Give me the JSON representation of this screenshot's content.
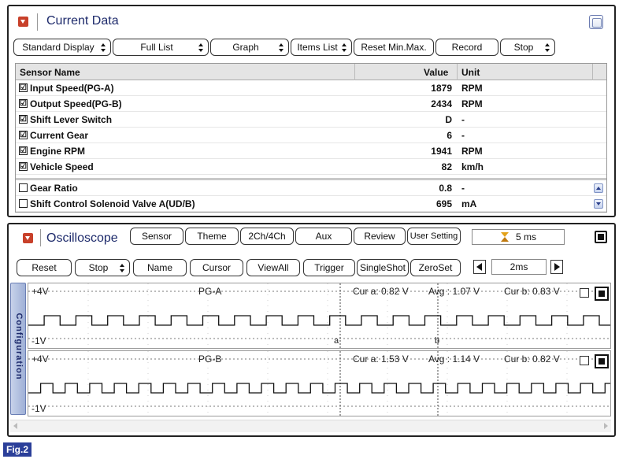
{
  "current_data": {
    "title": "Current Data",
    "toolbar": [
      {
        "label": "Standard Display",
        "spinner": true
      },
      {
        "label": "Full List",
        "spinner": true
      },
      {
        "label": "Graph",
        "spinner": true
      },
      {
        "label": "Items List",
        "spinner": true
      },
      {
        "label": "Reset Min.Max.",
        "spinner": false
      },
      {
        "label": "Record",
        "spinner": false
      },
      {
        "label": "Stop",
        "spinner": true
      }
    ],
    "columns": {
      "name": "Sensor Name",
      "value": "Value",
      "unit": "Unit"
    },
    "rows": [
      {
        "name": "Input Speed(PG-A)",
        "value": "1879",
        "unit": "RPM",
        "checked": true
      },
      {
        "name": "Output Speed(PG-B)",
        "value": "2434",
        "unit": "RPM",
        "checked": true
      },
      {
        "name": "Shift Lever Switch",
        "value": "D",
        "unit": "-",
        "checked": true
      },
      {
        "name": "Current Gear",
        "value": "6",
        "unit": "-",
        "checked": true
      },
      {
        "name": "Engine RPM",
        "value": "1941",
        "unit": "RPM",
        "checked": true
      },
      {
        "name": "Vehicle Speed",
        "value": "82",
        "unit": "km/h",
        "checked": true
      },
      {
        "name": "Gear Ratio",
        "value": "0.8",
        "unit": "-",
        "checked": false
      },
      {
        "name": "Shift Control Solenoid Valve A(UD/B)",
        "value": "695",
        "unit": "mA",
        "checked": false
      }
    ],
    "checkbox_glyph": "☑"
  },
  "oscilloscope": {
    "title": "Oscilloscope",
    "top_buttons": [
      "Sensor",
      "Theme",
      "2Ch/4Ch",
      "Aux",
      "Review",
      "User Setting"
    ],
    "time_display": "5 ms",
    "controls": [
      {
        "label": "Reset",
        "spinner": false
      },
      {
        "label": "Stop",
        "spinner": true
      },
      {
        "label": "Name",
        "spinner": false
      },
      {
        "label": "Cursor",
        "spinner": false
      },
      {
        "label": "ViewAll",
        "spinner": false
      },
      {
        "label": "Trigger",
        "spinner": false
      },
      {
        "label": "SingleShot",
        "spinner": false
      },
      {
        "label": "ZeroSet",
        "spinner": false
      }
    ],
    "timebase": "2ms",
    "configuration_label": "Configuration",
    "channels": [
      {
        "name": "PG-A",
        "top_level": "+4V",
        "bottom_level": "-1V",
        "cur_a": "Cur a: 0.82 V",
        "avg": "Avg : 1.07 V",
        "cur_b": "Cur b: 0.83 V",
        "marker_a": "a",
        "marker_b": "b",
        "pulse_period_ms": 1.06
      },
      {
        "name": "PG-B",
        "top_level": "+4V",
        "bottom_level": "-1V",
        "cur_a": "Cur a: 1.53 V",
        "avg": "Avg : 1.14 V",
        "cur_b": "Cur b: 0.82 V",
        "pulse_period_ms": 0.82
      }
    ]
  },
  "figure_label": "Fig.2",
  "colors": {
    "accent_red": "#c8402a",
    "title_navy": "#1d2a6b",
    "fig_label_bg": "#2b3f99"
  }
}
